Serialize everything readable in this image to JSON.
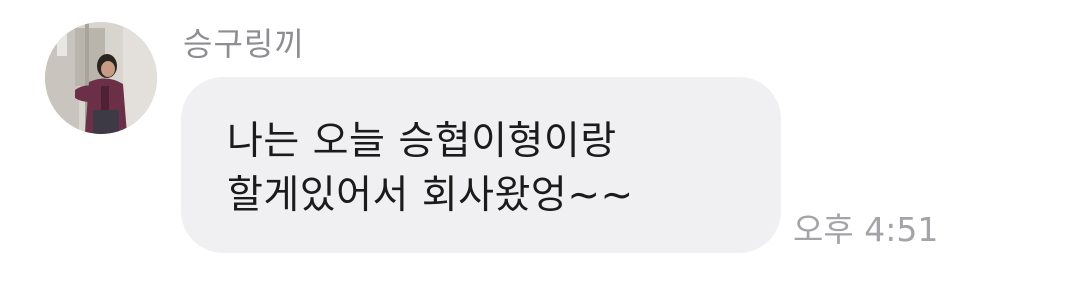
{
  "chat": {
    "sender_name": "승구링끼",
    "avatar_icon": "profile-photo-avatar",
    "message_lines": [
      "나는 오늘 승협이형이랑",
      "할게있어서 회사왔엉~~"
    ],
    "timestamp": "오후 4:51"
  },
  "colors": {
    "background": "#ffffff",
    "bubble": "#f0f0f2",
    "message_text": "#1b1b1c",
    "sender_name": "#8d8d92",
    "timestamp": "#a3a3a8"
  }
}
